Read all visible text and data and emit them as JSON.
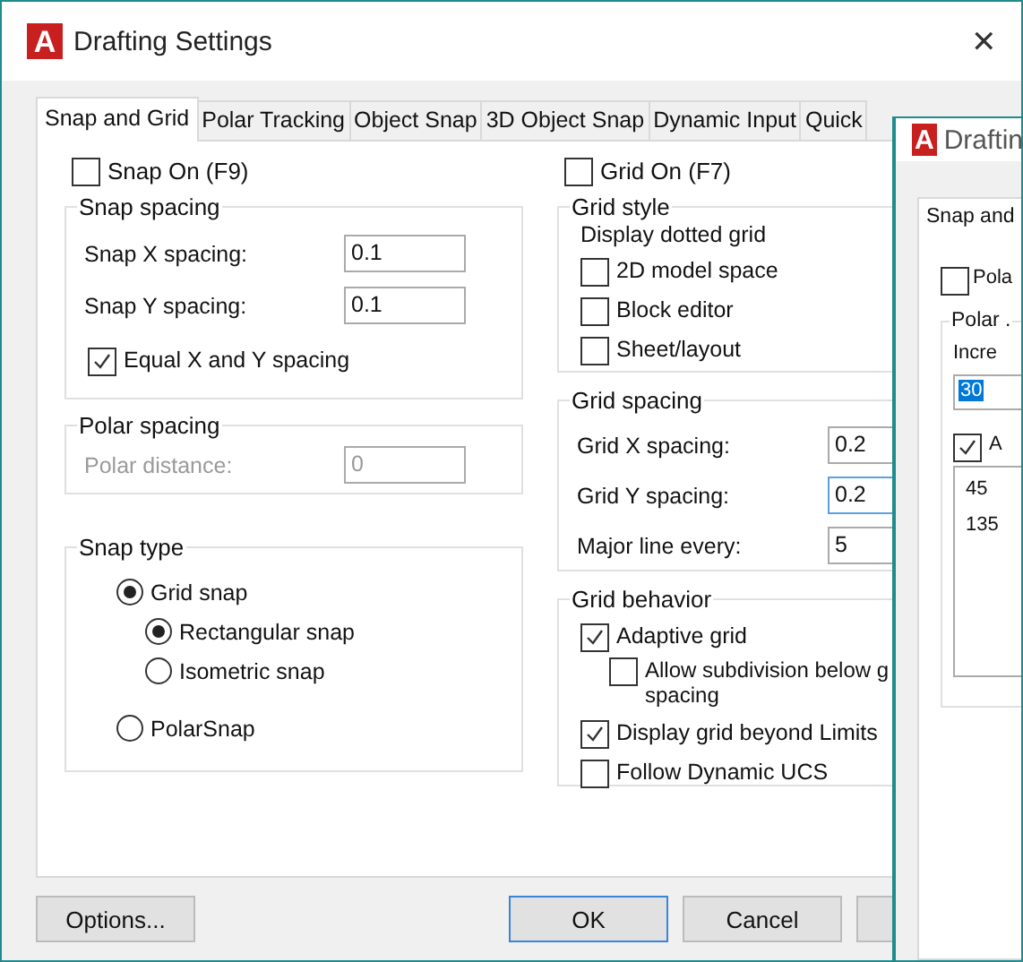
{
  "main_window": {
    "logo": "A",
    "title": "Drafting Settings",
    "close": "✕",
    "tabs": [
      {
        "label": "Snap and Grid",
        "selected": true
      },
      {
        "label": "Polar Tracking",
        "selected": false
      },
      {
        "label": "Object Snap",
        "selected": false
      },
      {
        "label": "3D Object Snap",
        "selected": false
      },
      {
        "label": "Dynamic Input",
        "selected": false
      },
      {
        "label": "Quick",
        "selected": false
      }
    ],
    "snap_on": {
      "label": "Snap On (F9)",
      "checked": false
    },
    "snap_spacing": {
      "title": "Snap spacing",
      "fields": [
        {
          "label": "Snap X spacing:",
          "value": "0.1",
          "disabled": false,
          "focused": false
        },
        {
          "label": "Snap Y spacing:",
          "value": "0.1",
          "disabled": false,
          "focused": false
        }
      ],
      "equal": {
        "label": "Equal X and Y spacing",
        "checked": true
      }
    },
    "polar_spacing": {
      "title": "Polar spacing",
      "fields": [
        {
          "label": "Polar distance:",
          "value": "0",
          "disabled": true,
          "focused": false
        }
      ]
    },
    "snap_type": {
      "title": "Snap type",
      "options": [
        {
          "label": "Grid snap",
          "selected": true,
          "children": [
            {
              "label": "Rectangular snap",
              "selected": true
            },
            {
              "label": "Isometric snap",
              "selected": false
            }
          ]
        },
        {
          "label": "PolarSnap",
          "selected": false
        }
      ]
    },
    "grid_on": {
      "label": "Grid On (F7)",
      "checked": false
    },
    "grid_style": {
      "title": "Grid style",
      "subtitle": "Display dotted grid",
      "options": [
        {
          "label": "2D model space",
          "checked": false
        },
        {
          "label": "Block editor",
          "checked": false
        },
        {
          "label": "Sheet/layout",
          "checked": false
        }
      ]
    },
    "grid_spacing": {
      "title": "Grid spacing",
      "fields": [
        {
          "label": "Grid X spacing:",
          "value": "0.2",
          "disabled": false,
          "focused": false
        },
        {
          "label": "Grid Y spacing:",
          "value": "0.2",
          "disabled": false,
          "focused": true
        },
        {
          "label": "Major line every:",
          "value": "5",
          "disabled": false,
          "focused": false
        }
      ]
    },
    "grid_behavior": {
      "title": "Grid behavior",
      "options": [
        {
          "label": "Adaptive grid",
          "checked": true,
          "children": [
            {
              "label": "Allow subdivision below g\nspacing",
              "checked": false
            }
          ]
        },
        {
          "label": "Display grid beyond Limits",
          "checked": true
        },
        {
          "label": "Follow Dynamic UCS",
          "checked": false
        }
      ]
    },
    "buttons": [
      {
        "label": "Options...",
        "default": false
      },
      {
        "label": "OK",
        "default": true
      },
      {
        "label": "Cancel",
        "default": false
      }
    ]
  },
  "second_window": {
    "logo": "A",
    "title": "Draftin",
    "tab": "Snap and",
    "polar_on": {
      "label": "Pola",
      "checked": false
    },
    "group_title": "Polar .",
    "increment_label": "Incre",
    "increment_value": "30",
    "additional": {
      "label": "A",
      "checked": true
    },
    "angles": [
      "45",
      "135"
    ]
  }
}
